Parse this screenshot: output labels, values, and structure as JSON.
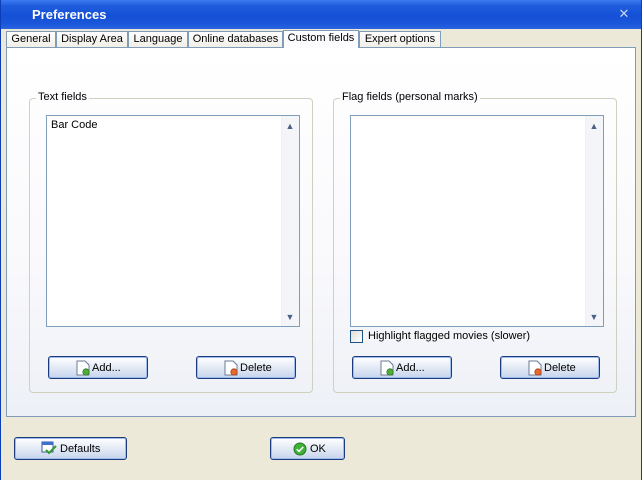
{
  "window": {
    "title": "Preferences",
    "close_glyph": "✕"
  },
  "tabs": [
    {
      "label": "General"
    },
    {
      "label": "Display Area"
    },
    {
      "label": "Language"
    },
    {
      "label": "Online databases"
    },
    {
      "label": "Custom fields",
      "active": true
    },
    {
      "label": "Expert options"
    }
  ],
  "text_fields": {
    "legend": "Text fields",
    "items": [
      "Bar Code"
    ],
    "add_label": "Add...",
    "delete_label": "Delete"
  },
  "flag_fields": {
    "legend": "Flag fields (personal marks)",
    "items": [],
    "highlight_label": "Highlight flagged movies (slower)",
    "highlight_checked": false,
    "add_label": "Add...",
    "delete_label": "Delete"
  },
  "footer": {
    "defaults_label": "Defaults",
    "ok_label": "OK"
  },
  "icons": {
    "add": "document-add-icon",
    "delete": "document-delete-icon",
    "defaults": "defaults-check-icon",
    "ok": "ok-check-icon"
  }
}
